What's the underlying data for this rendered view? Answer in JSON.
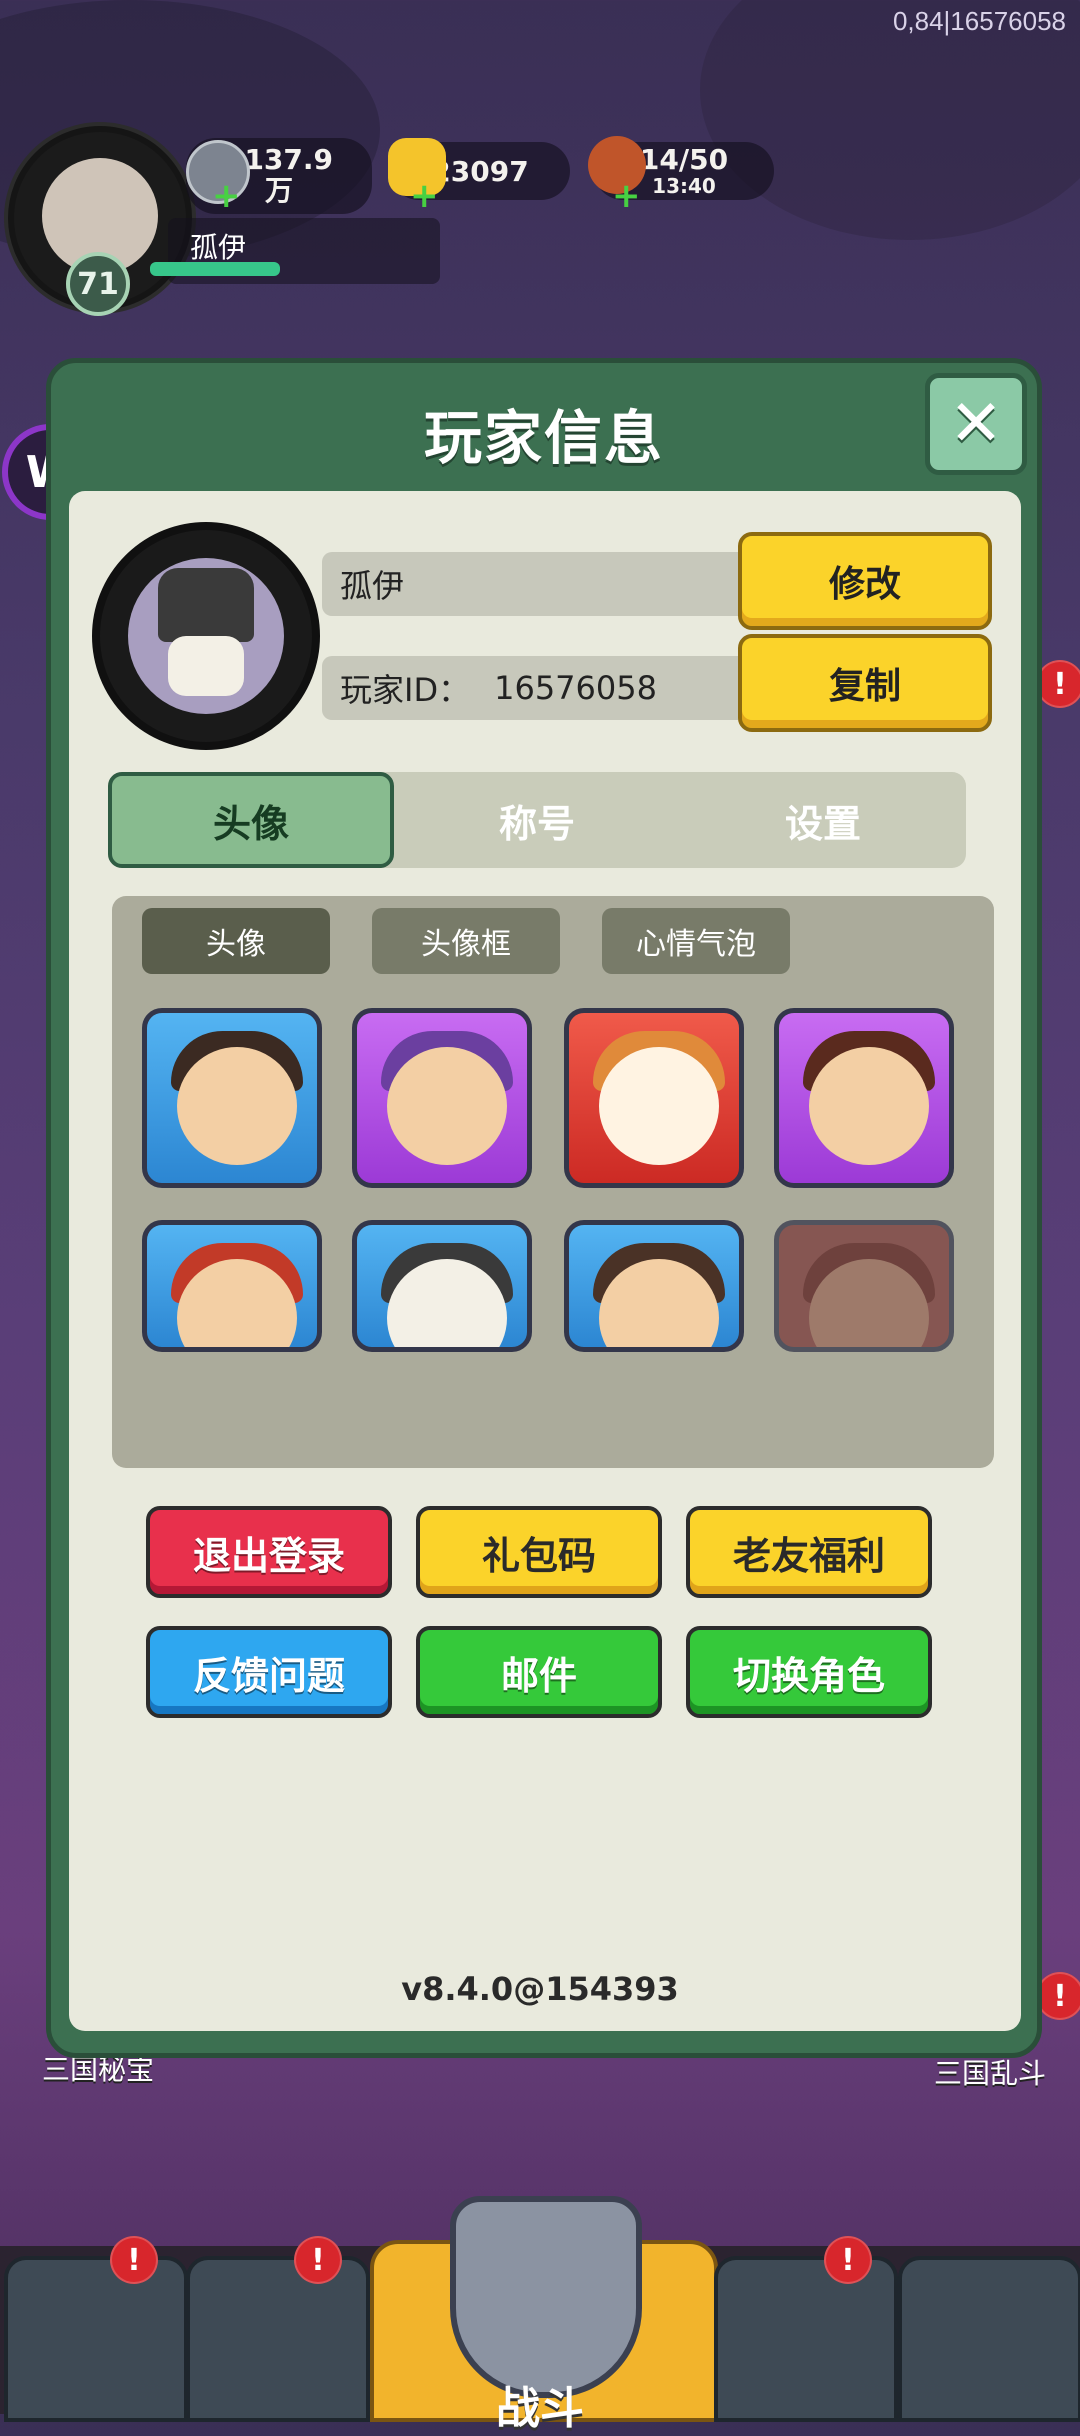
{
  "corner_text": "0,84|16576058",
  "hud": {
    "level": "71",
    "silver": "1137.9\n万",
    "silver_line1": "1137.9",
    "silver_line2": "万",
    "gold": "23097",
    "stamina": "14/50",
    "stamina_timer": "13:40",
    "player_name": "孤伊"
  },
  "panel": {
    "title": "玩家信息",
    "name_field": "孤伊",
    "id_label": "玩家ID：",
    "id_value": "16576058",
    "modify_label": "修改",
    "copy_label": "复制"
  },
  "tabs": [
    "头像",
    "称号",
    "设置"
  ],
  "active_tab": "头像",
  "subtabs": [
    "头像",
    "头像框",
    "心情气泡"
  ],
  "avatars": [
    {
      "name": "avatar-tile-1",
      "color": "blue"
    },
    {
      "name": "avatar-tile-2",
      "color": "purple"
    },
    {
      "name": "avatar-tile-3",
      "color": "red"
    },
    {
      "name": "avatar-tile-4",
      "color": "purple"
    },
    {
      "name": "avatar-tile-5",
      "color": "blue"
    },
    {
      "name": "avatar-tile-6",
      "color": "blue"
    },
    {
      "name": "avatar-tile-7",
      "color": "blue"
    },
    {
      "name": "avatar-tile-8",
      "color": "dark"
    }
  ],
  "actions": {
    "logout": "退出登录",
    "gift_code": "礼包码",
    "old_friend": "老友福利",
    "feedback": "反馈问题",
    "mail": "邮件",
    "switch_role": "切换角色"
  },
  "version": "v8.4.0@154393",
  "side_labels": {
    "left_bottom": "三国秘宝",
    "right_bottom": "三国乱斗"
  },
  "bottom_nav": {
    "battle_label": "战斗"
  },
  "colors": {
    "panel_green": "#3c7051",
    "accent_yellow": "#fbd32a",
    "alert_red": "#d8262c"
  }
}
